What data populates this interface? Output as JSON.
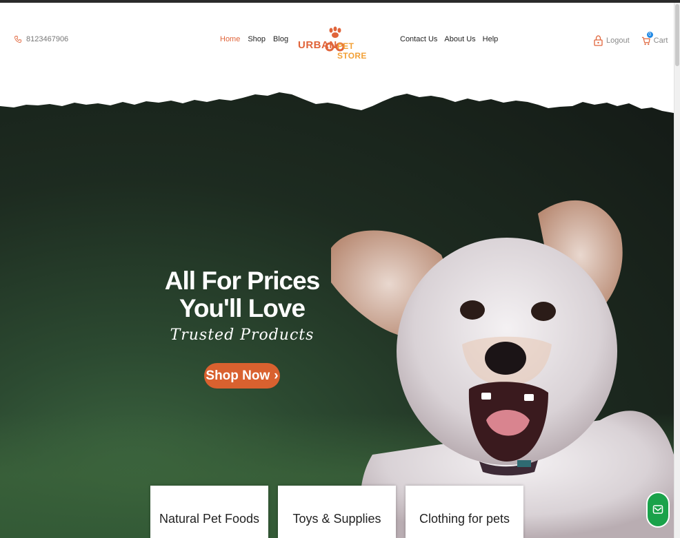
{
  "header": {
    "phone": "8123467906",
    "nav_left": [
      {
        "label": "Home",
        "active": true
      },
      {
        "label": "Shop",
        "active": false
      },
      {
        "label": "Blog",
        "active": false
      }
    ],
    "logo": {
      "word1": "URBAN",
      "word2": "PET STORE",
      "icon": "paw-icon"
    },
    "nav_right": [
      {
        "label": "Contact Us"
      },
      {
        "label": "About Us"
      },
      {
        "label": "Help"
      }
    ],
    "logout_label": "Logout",
    "cart_label": "Cart",
    "cart_count": "0"
  },
  "hero": {
    "title_line1": "All For Prices",
    "title_line2": "You'll Love",
    "script_text": "Trusted Products",
    "button_label": "Shop Now",
    "button_icon": "chevron-right-icon"
  },
  "categories": [
    "Natural Pet Foods",
    "Toys & Supplies",
    "Clothing for pets"
  ],
  "colors": {
    "accent": "#e0643a",
    "button": "#d9612f",
    "logo_secondary": "#f2a036",
    "chat": "#1aa24a",
    "badge": "#1e88e5"
  }
}
